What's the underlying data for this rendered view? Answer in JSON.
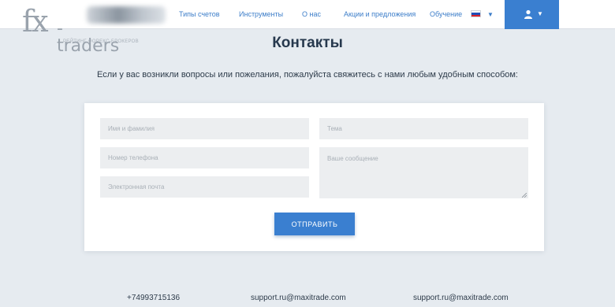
{
  "header": {
    "logo_fx": "fx",
    "logo_traders": "-traders",
    "logo_tagline": "РЕЙТИНГ ФОРЕКС-БРОКЕРОВ",
    "nav": [
      {
        "label": "Типы счетов"
      },
      {
        "label": "Инструменты"
      },
      {
        "label": "О нас"
      },
      {
        "label": "Акции и предложения"
      },
      {
        "label": "Обучение"
      }
    ],
    "language_flag": "russian-flag-icon",
    "accent_color": "#3a7fd0"
  },
  "page": {
    "title": "Контакты",
    "intro": "Если у вас возникли вопросы или пожелания, пожалуйста свяжитесь с нами любым удобным способом:"
  },
  "form": {
    "name_placeholder": "Имя и фамилия",
    "phone_placeholder": "Номер телефона",
    "email_placeholder": "Электронная почта",
    "subject_placeholder": "Тема",
    "message_placeholder": "Ваше сообщение",
    "submit_label": "ОТПРАВИТЬ"
  },
  "footer": {
    "phone": "+74993715136",
    "email_1": "support.ru@maxitrade.com",
    "email_2": "support.ru@maxitrade.com"
  }
}
